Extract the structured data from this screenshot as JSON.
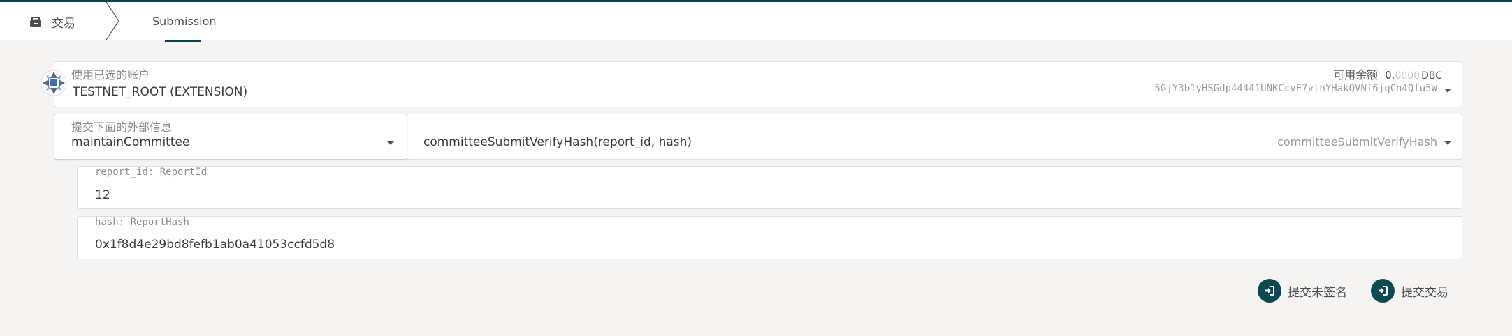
{
  "header": {
    "section_label": "交易",
    "tabs": [
      {
        "label": "Submission",
        "active": true
      }
    ]
  },
  "account": {
    "label": "使用已选的账户",
    "name": "TESTNET_ROOT (EXTENSION)",
    "balance_label": "可用余额",
    "balance_whole": "0.",
    "balance_decimals": "0000",
    "balance_unit": "DBC",
    "address": "5GjY3b1yHSGdp44441UNKCcvF7vthYHakQVNf6jqCn4Qfu5W"
  },
  "extrinsic": {
    "label": "提交下面的外部信息",
    "module": "maintainCommittee",
    "method_signature": "committeeSubmitVerifyHash(report_id, hash)",
    "method_name": "committeeSubmitVerifyHash"
  },
  "params": [
    {
      "label": "report_id: ReportId",
      "value": "12"
    },
    {
      "label": "hash: ReportHash",
      "value": "0x1f8d4e29bd8fefb1ab0a41053ccfd5d8"
    }
  ],
  "actions": {
    "submit_unsigned": "提交未签名",
    "submit_transaction": "提交交易"
  },
  "colors": {
    "accent": "#00454f",
    "button": "#0b4a52",
    "background": "#f5f4f3"
  }
}
